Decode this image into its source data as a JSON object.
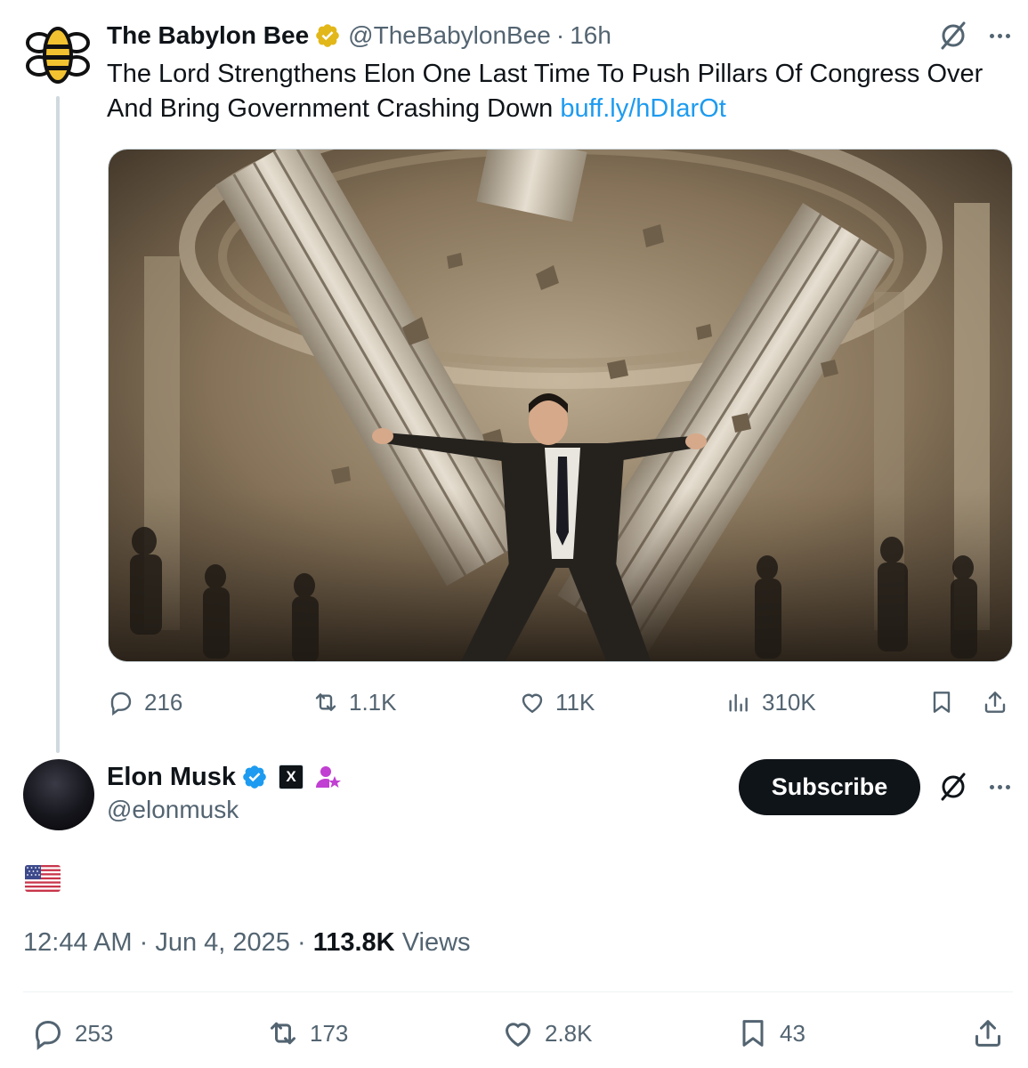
{
  "parent_tweet": {
    "display_name": "The Babylon Bee",
    "handle": "@TheBabylonBee",
    "separator": "·",
    "time_ago": "16h",
    "text": "The Lord Strengthens Elon One Last Time To Push Pillars Of Congress Over And Bring Government Crashing Down",
    "link": "buff.ly/hDIarOt",
    "stats": {
      "replies": "216",
      "reposts": "1.1K",
      "likes": "11K",
      "views": "310K"
    }
  },
  "main_tweet": {
    "display_name": "Elon Musk",
    "handle": "@elonmusk",
    "subscribe_label": "Subscribe",
    "affiliate_badge": "X",
    "time": "12:44 AM",
    "date": "Jun 4, 2025",
    "separator": "·",
    "views_count": "113.8K",
    "views_label": "Views",
    "stats": {
      "replies": "253",
      "reposts": "173",
      "likes": "2.8K",
      "bookmarks": "43"
    }
  },
  "icons": {
    "verified_gold": "verified-gold-badge-icon",
    "verified_blue": "verified-blue-badge-icon",
    "grok": "grok-icon",
    "more": "more-icon",
    "reply": "reply-icon",
    "repost": "repost-icon",
    "like": "like-icon",
    "views": "views-icon",
    "bookmark": "bookmark-icon",
    "share": "share-icon",
    "flag": "us-flag-icon"
  },
  "colors": {
    "link": "#1d9bf0",
    "muted": "#536471",
    "text": "#0f1419",
    "verified_gold": "#e2b719",
    "verified_blue": "#1d9bf0",
    "premium_purple": "#c13fd2"
  }
}
